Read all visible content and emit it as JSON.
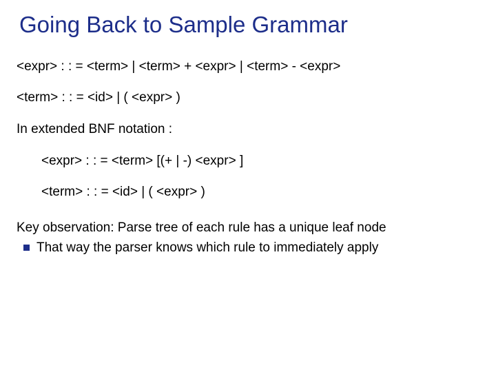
{
  "title": "Going Back to Sample Grammar",
  "lines": {
    "bnf_expr": "<expr> : : = <term> | <term> + <expr>  | <term> - <expr>",
    "bnf_term": "<term> : : = <id> | ( <expr> )",
    "ebnf_intro": "In extended BNF notation :",
    "ebnf_expr": "<expr> : : = <term> [(+ | -) <expr> ]",
    "ebnf_term": "<term> : : = <id> | ( <expr> )",
    "key_obs": "Key observation: Parse tree of each rule has a unique leaf node",
    "bullet1": "That way the parser knows which rule to immediately apply"
  }
}
